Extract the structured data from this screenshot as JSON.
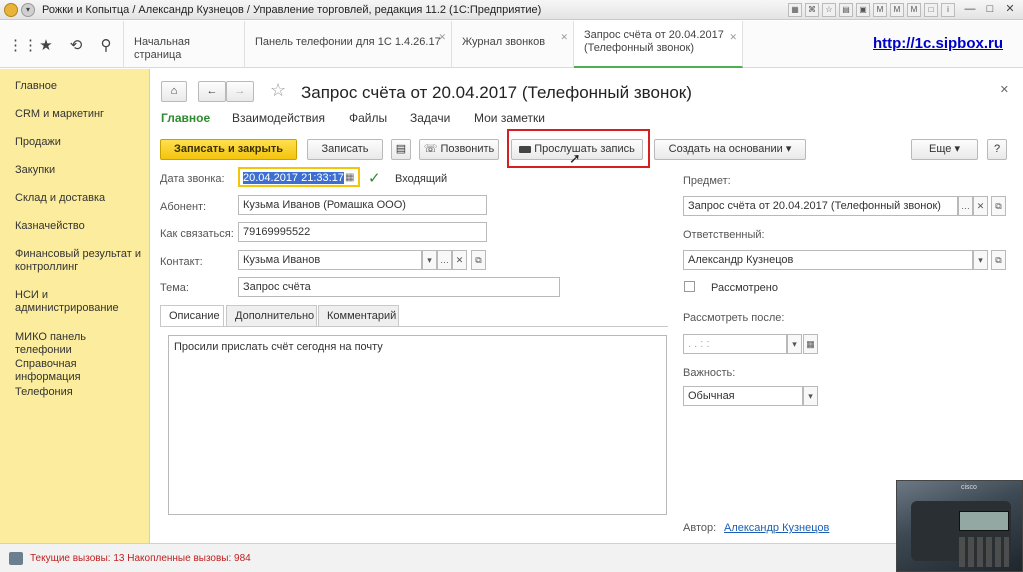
{
  "window": {
    "title": "Рожки и Копытца / Александр Кузнецов / Управление торговлей, редакция 11.2  (1С:Предприятие)"
  },
  "tabs": [
    {
      "label": "Начальная страница"
    },
    {
      "label": "Панель телефонии для 1С 1.4.26.17"
    },
    {
      "label": "Журнал звонков"
    },
    {
      "label": "Запрос счёта от 20.04.2017 (Телефонный звонок)"
    }
  ],
  "site_link": "http://1c.sipbox.ru",
  "sidebar": {
    "items": [
      {
        "label": "Главное"
      },
      {
        "label": "CRM и маркетинг"
      },
      {
        "label": "Продажи"
      },
      {
        "label": "Закупки"
      },
      {
        "label": "Склад и доставка"
      },
      {
        "label": "Казначейство"
      },
      {
        "label": "Финансовый результат и контроллинг"
      },
      {
        "label": "НСИ и администрирование"
      },
      {
        "label": "МИКО панель телефонии"
      },
      {
        "label": "Справочная информация"
      },
      {
        "label": "Телефония"
      }
    ]
  },
  "form": {
    "title": "Запрос счёта от 20.04.2017 (Телефонный звонок)",
    "sections": [
      "Главное",
      "Взаимодействия",
      "Файлы",
      "Задачи",
      "Мои заметки"
    ],
    "toolbar": {
      "save_close": "Записать и закрыть",
      "save": "Записать",
      "call": "Позвонить",
      "listen": "Прослушать запись",
      "create_based": "Создать на основании",
      "more": "Еще",
      "help": "?"
    },
    "call_date": {
      "label": "Дата звонка:",
      "value": "20.04.2017 21:33:17"
    },
    "incoming": {
      "label": "Входящий",
      "checked": true
    },
    "subscriber": {
      "label": "Абонент:",
      "value": "Кузьма Иванов (Ромашка ООО)"
    },
    "contact_how": {
      "label": "Как связаться:",
      "value": "79169995522"
    },
    "contact": {
      "label": "Контакт:",
      "value": "Кузьма Иванов"
    },
    "topic": {
      "label": "Тема:",
      "value": "Запрос счёта"
    },
    "inner_tabs": [
      "Описание",
      "Дополнительно",
      "Комментарий"
    ],
    "description": "Просили прислать счёт сегодня на почту",
    "subject": {
      "label": "Предмет:",
      "value": "Запрос счёта от 20.04.2017 (Телефонный звонок)"
    },
    "responsible": {
      "label": "Ответственный:",
      "value": "Александр Кузнецов"
    },
    "reviewed": {
      "label": "Рассмотрено",
      "checked": false
    },
    "review_after": {
      "label": "Рассмотреть после:",
      "value": "  .  .        :  :"
    },
    "importance": {
      "label": "Важность:",
      "value": "Обычная"
    },
    "author": {
      "label": "Автор:",
      "value": "Александр Кузнецов"
    }
  },
  "status": {
    "text": "Текущие вызовы: 13   Накопленные вызовы: 984"
  },
  "webcam": {
    "brand": "cisco"
  }
}
